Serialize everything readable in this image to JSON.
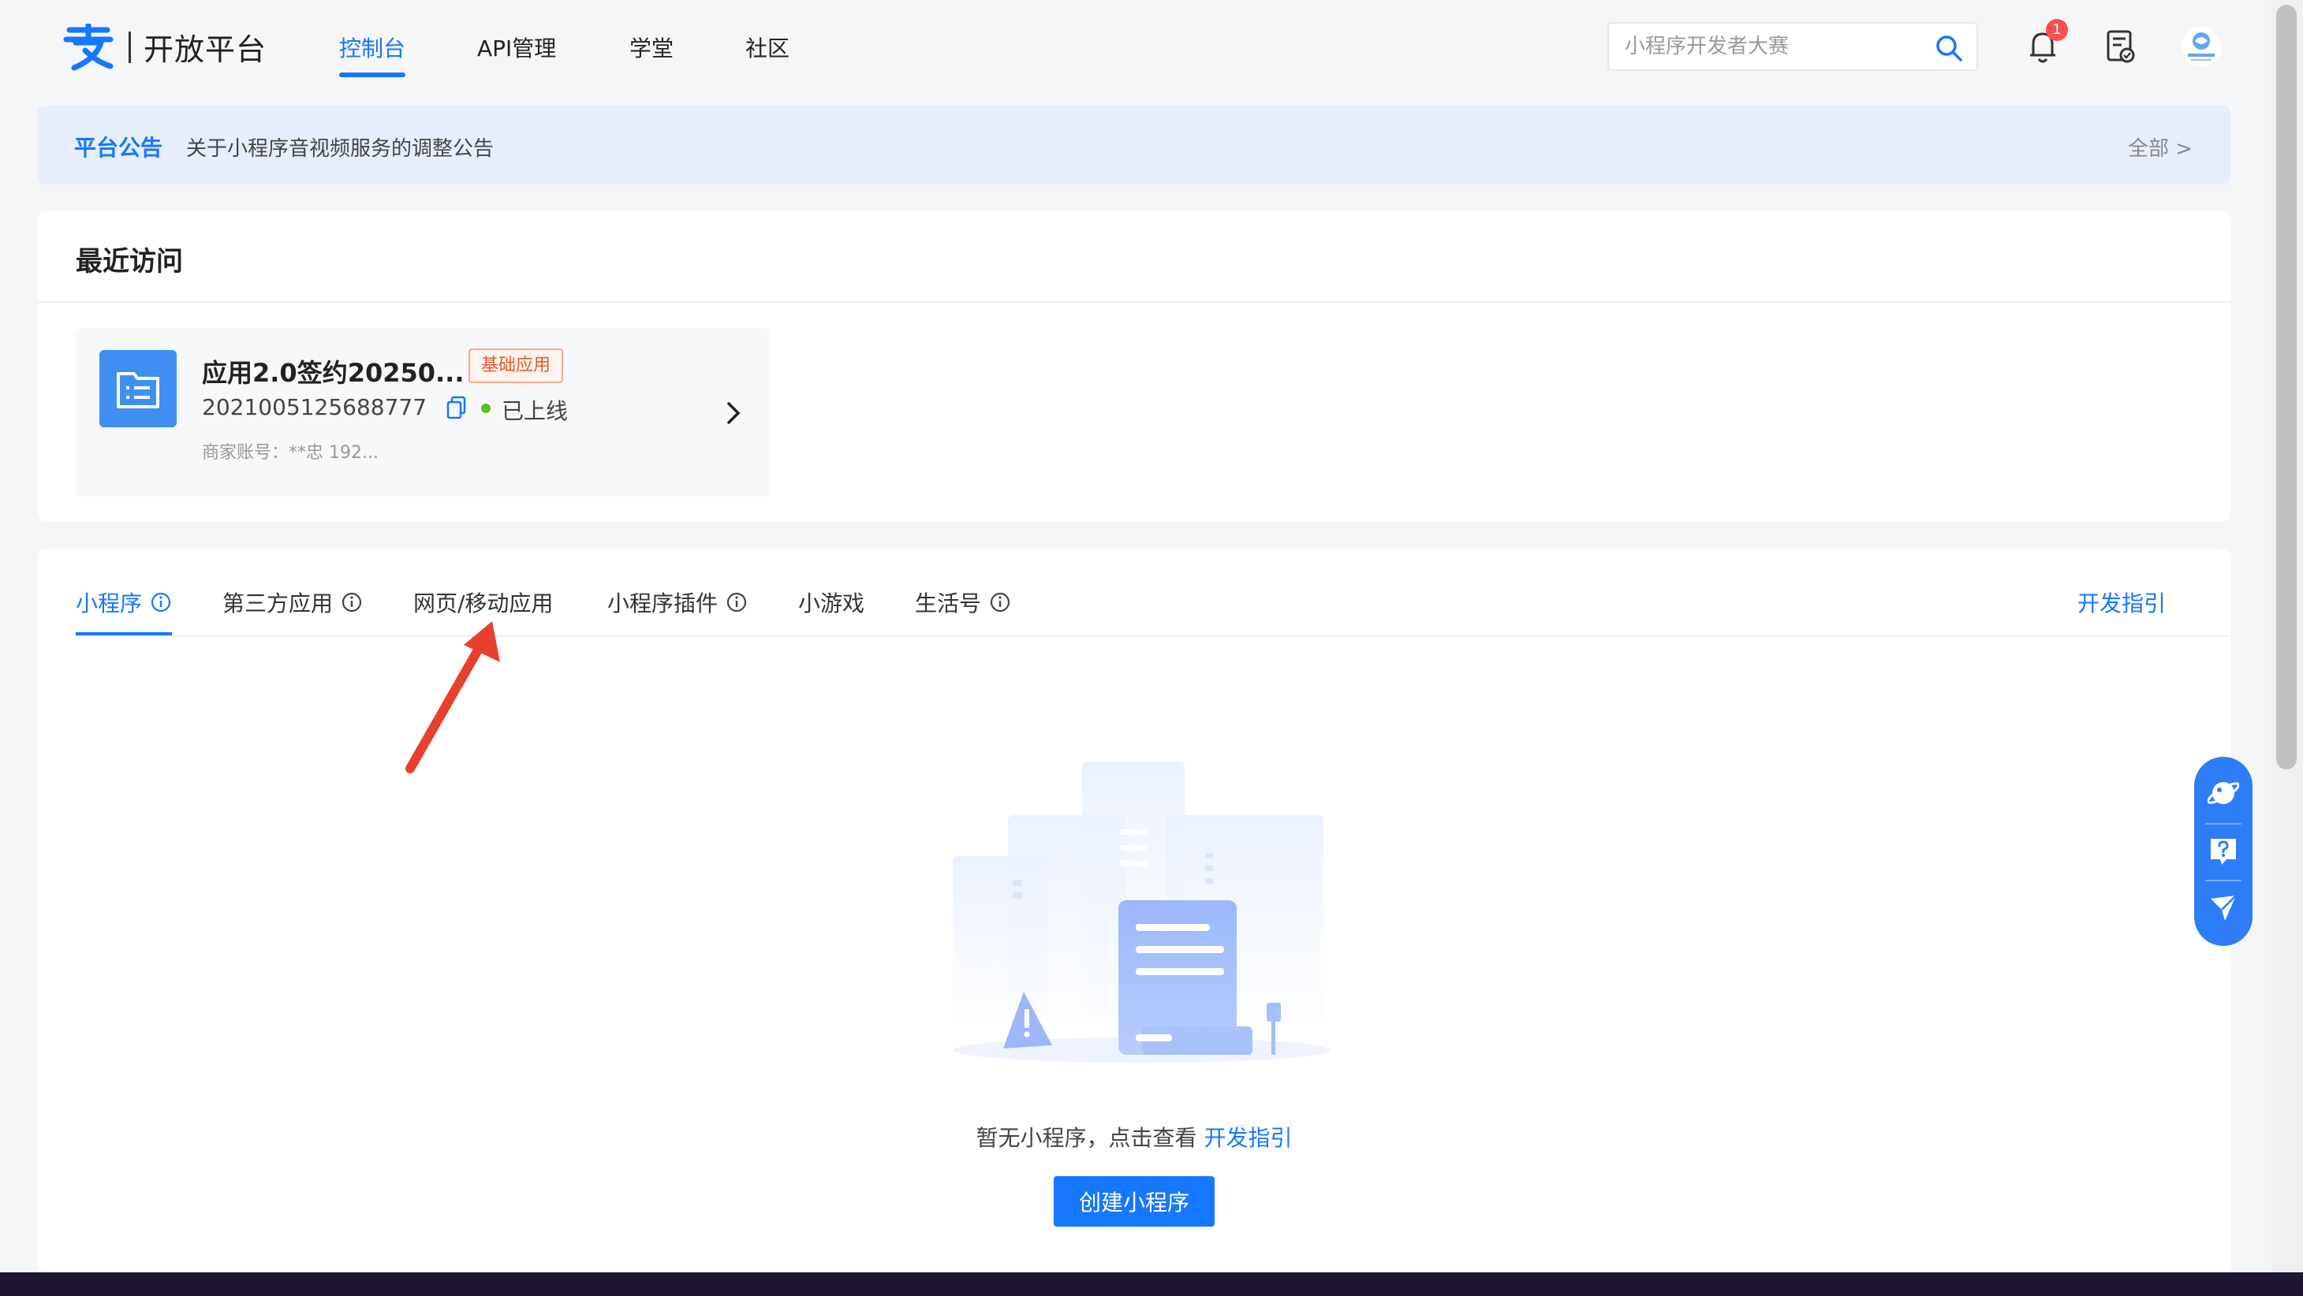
{
  "nav": {
    "logo_text": "开放平台",
    "items": [
      {
        "label": "控制台",
        "active": true
      },
      {
        "label": "API管理"
      },
      {
        "label": "学堂"
      },
      {
        "label": "社区"
      }
    ],
    "search_placeholder": "小程序开发者大赛",
    "notification_count": "1"
  },
  "announcement": {
    "title": "平台公告",
    "text": "关于小程序音视频服务的调整公告",
    "all_label": "全部 >"
  },
  "recent": {
    "title": "最近访问",
    "app": {
      "name": "应用2.0签约20250...",
      "tag": "基础应用",
      "id": "2021005125688777",
      "status": "已上线",
      "merchant": "商家账号：**忠  192..."
    }
  },
  "tabs": {
    "items": [
      {
        "label": "小程序",
        "info": true,
        "active": true
      },
      {
        "label": "第三方应用",
        "info": true
      },
      {
        "label": "网页/移动应用",
        "info": false
      },
      {
        "label": "小程序插件",
        "info": true
      },
      {
        "label": "小游戏",
        "info": false
      },
      {
        "label": "生活号",
        "info": true
      }
    ],
    "guide_link": "开发指引"
  },
  "empty": {
    "text": "暂无小程序，点击查看",
    "link": "开发指引",
    "button": "创建小程序"
  },
  "colors": {
    "primary": "#1677ff",
    "tag_orange": "#e8572c",
    "online_green": "#52c41a",
    "annotation_red": "#e8402e"
  }
}
